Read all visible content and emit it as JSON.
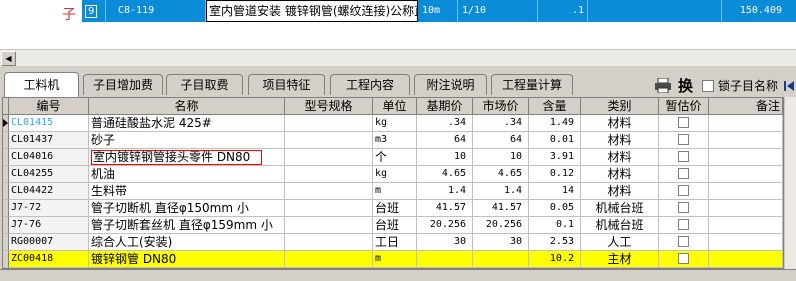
{
  "quota_row": {
    "index": "9",
    "code": "C8-119",
    "name": "室内管道安装 镀锌钢管(螺纹连接)公称直径",
    "unit": "10m",
    "quantity_expr": "1/10",
    "quantity": ".1",
    "price": "150.409"
  },
  "tabs": [
    {
      "label": "工料机"
    },
    {
      "label": "子目增加费"
    },
    {
      "label": "子目取费"
    },
    {
      "label": "项目特征"
    },
    {
      "label": "工程内容"
    },
    {
      "label": "附注说明"
    },
    {
      "label": "工程量计算"
    }
  ],
  "toolbar": {
    "swap_label": "换",
    "lock_label": "锁子目名称"
  },
  "columns": [
    "编号",
    "名称",
    "型号规格",
    "单位",
    "基期价",
    "市场价",
    "含量",
    "类别",
    "暂估价",
    "备注"
  ],
  "rows": [
    {
      "code": "CL01415",
      "name": "普通硅酸盐水泥 425#",
      "spec": "",
      "unit": "kg",
      "base": ".34",
      "market": ".34",
      "qty": "1.49",
      "type": "材料"
    },
    {
      "code": "CL01437",
      "name": "砂子",
      "spec": "",
      "unit": "m3",
      "base": "64",
      "market": "64",
      "qty": "0.01",
      "type": "材料"
    },
    {
      "code": "CL04016",
      "name": "室内镀锌钢管接头零件 DN80",
      "spec": "",
      "unit": "个",
      "base": "10",
      "market": "10",
      "qty": "3.91",
      "type": "材料"
    },
    {
      "code": "CL04255",
      "name": "机油",
      "spec": "",
      "unit": "kg",
      "base": "4.65",
      "market": "4.65",
      "qty": "0.12",
      "type": "材料"
    },
    {
      "code": "CL04422",
      "name": "生料带",
      "spec": "",
      "unit": "m",
      "base": "1.4",
      "market": "1.4",
      "qty": "14",
      "type": "材料"
    },
    {
      "code": "J7-72",
      "name": "管子切断机 直径φ150mm 小",
      "spec": "",
      "unit": "台班",
      "base": "41.57",
      "market": "41.57",
      "qty": "0.05",
      "type": "机械台班"
    },
    {
      "code": "J7-76",
      "name": "管子切断套丝机 直径φ159mm 小",
      "spec": "",
      "unit": "台班",
      "base": "20.256",
      "market": "20.256",
      "qty": "0.1",
      "type": "机械台班"
    },
    {
      "code": "RG00007",
      "name": "综合人工(安装)",
      "spec": "",
      "unit": "工日",
      "base": "30",
      "market": "30",
      "qty": "2.53",
      "type": "人工"
    },
    {
      "code": "ZC00418",
      "name": "镀锌钢管 DN80",
      "spec": "",
      "unit": "m",
      "base": "",
      "market": "",
      "qty": "10.2",
      "type": "主材"
    }
  ],
  "colors": {
    "selection_blue": "#0a8cd8",
    "highlight_yellow": "#ffff00",
    "error_red": "#ff0000",
    "chrome": "#d4d0c8"
  }
}
